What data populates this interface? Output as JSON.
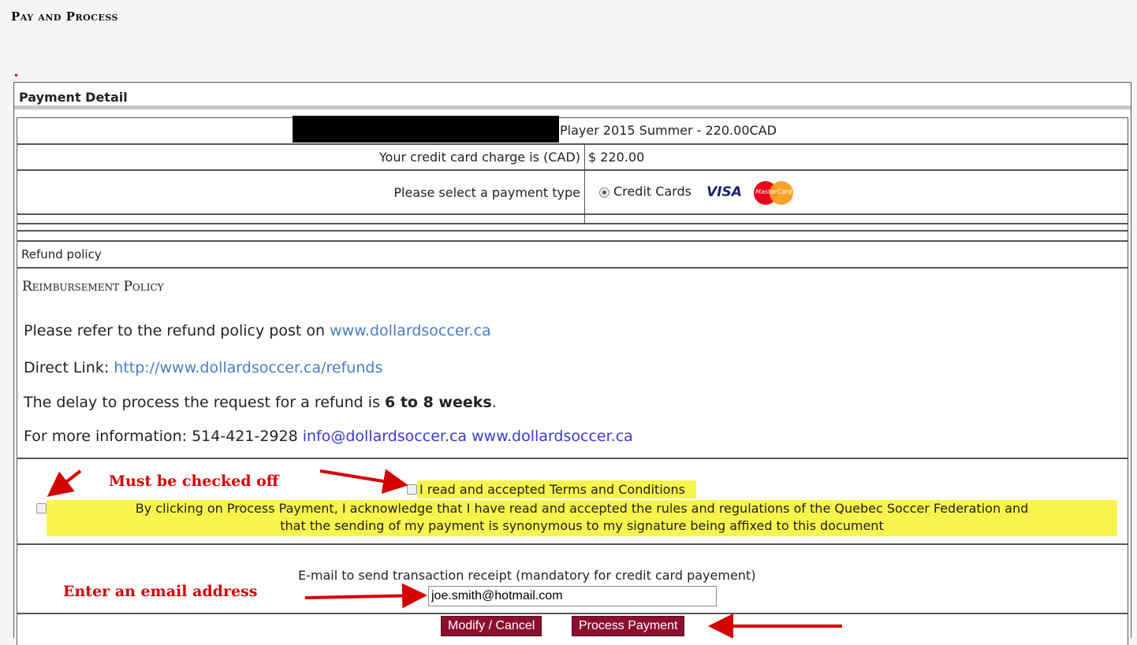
{
  "page_title": "Pay and Process",
  "panel_title": "Payment Detail",
  "plan_line": "Player 2015 Summer - 220.00CAD",
  "charge": {
    "label": "Your credit card charge is (CAD)",
    "value": "$ 220.00"
  },
  "payment_type": {
    "label": "Please select a payment type",
    "option": "Credit Cards",
    "visa": "VISA",
    "mastercard": "MasterCard"
  },
  "refund": {
    "label": "Refund policy",
    "heading": "Reimbursement Policy",
    "line1_text": "Please refer to the refund policy post on ",
    "line1_link": "www.dollardsoccer.ca",
    "line2_text": "Direct Link: ",
    "line2_link": "http://www.dollardsoccer.ca/refunds",
    "line3_text": "The delay to process the request for a refund is ",
    "line3_bold": "6 to 8 weeks",
    "line3_end": ".",
    "line4_text": "For more information: 514-421-2928 ",
    "line4_email": "info@dollardsoccer.ca",
    "line4_site": "www.dollardsoccer.ca"
  },
  "terms": {
    "accept_label": "I read and accepted Terms and Conditions",
    "ack_line1": "By clicking on Process Payment, I acknowledge that I have read and accepted the rules and regulations of the Quebec Soccer Federation and",
    "ack_line2": "that the sending of my payment is synonymous to my signature being affixed to this document"
  },
  "annotations": {
    "check": "Must be checked off",
    "email": "Enter an email address"
  },
  "email": {
    "label": "E-mail to send transaction receipt (mandatory for credit card payement)",
    "value": "joe.smith@hotmail.com"
  },
  "buttons": {
    "modify": "Modify / Cancel",
    "process": "Process Payment"
  },
  "colors": {
    "button_bg": "#8b0f30",
    "highlight": "#f7f54d",
    "annotation": "#d40000",
    "link": "#4a7ec2"
  }
}
